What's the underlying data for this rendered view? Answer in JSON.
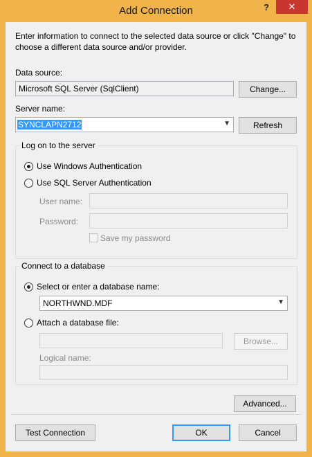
{
  "window": {
    "title": "Add Connection",
    "help_glyph": "?",
    "close_glyph": "✕"
  },
  "intro_text": "Enter information to connect to the selected data source or click \"Change\" to choose a different data source and/or provider.",
  "data_source": {
    "label": "Data source:",
    "value": "Microsoft SQL Server (SqlClient)",
    "change_label": "Change..."
  },
  "server": {
    "label": "Server name:",
    "value": "SYNCLAPN2712",
    "refresh_label": "Refresh"
  },
  "logon": {
    "group_title": "Log on to the server",
    "windows_auth_label": "Use Windows Authentication",
    "windows_auth_checked": true,
    "sql_auth_label": "Use SQL Server Authentication",
    "sql_auth_checked": false,
    "username_label": "User name:",
    "username_value": "",
    "password_label": "Password:",
    "password_value": "",
    "save_password_label": "Save my password",
    "save_password_checked": false
  },
  "database": {
    "group_title": "Connect to a database",
    "select_label": "Select or enter a database name:",
    "select_checked": true,
    "db_name_value": "NORTHWND.MDF",
    "attach_label": "Attach a database file:",
    "attach_checked": false,
    "attach_file_value": "",
    "browse_label": "Browse...",
    "logical_name_label": "Logical name:",
    "logical_name_value": ""
  },
  "footer": {
    "advanced_label": "Advanced...",
    "test_label": "Test Connection",
    "ok_label": "OK",
    "cancel_label": "Cancel"
  },
  "icons": {
    "dropdown": "chevron-down-icon",
    "help": "help-icon",
    "close": "close-icon"
  },
  "colors": {
    "titlebar": "#f0b44a",
    "close_button": "#c7372f",
    "selection": "#3399ff",
    "dialog_bg": "#f0f0f0"
  }
}
